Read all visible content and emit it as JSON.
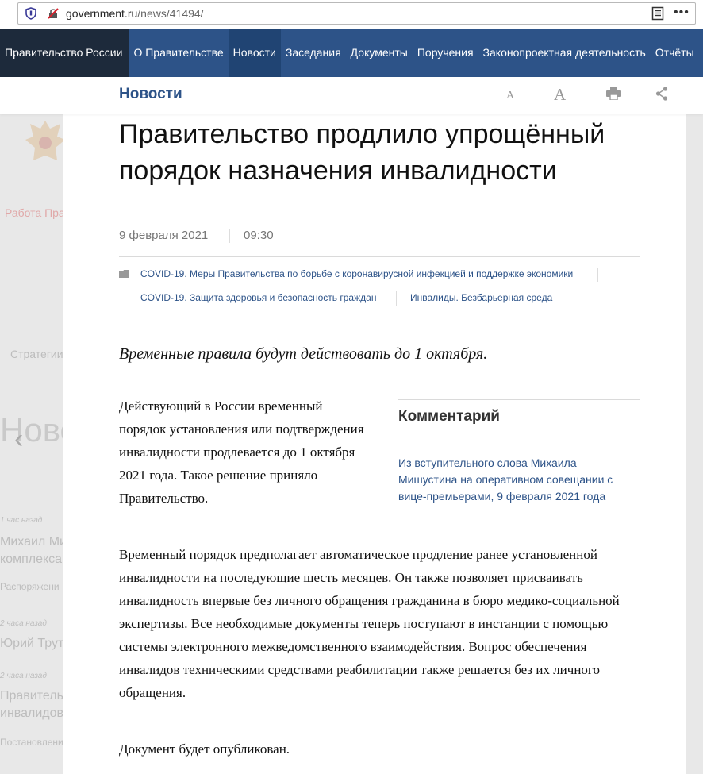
{
  "browser": {
    "url_domain": "government.ru",
    "url_path": "/news/41494/",
    "menu_glyph": "•••"
  },
  "topnav": {
    "brand": "Правительство России",
    "items": [
      "О Правительстве",
      "Новости",
      "Заседания",
      "Документы",
      "Поручения",
      "Законопроектная деятельность",
      "Отчёты"
    ],
    "active_index": 1
  },
  "section": {
    "title": "Новости",
    "font_small_label": "A",
    "font_large_label": "A"
  },
  "background": {
    "work_link": "Работа Пра",
    "strategies": "Стратегии",
    "heading": "Ново",
    "prev_arrow": "‹",
    "items": [
      {
        "time": "1 час назад",
        "title1": "Михаил Ми",
        "title2": "комплекса",
        "sub": "Распоряжени"
      },
      {
        "time": "2 часа назад",
        "title1": "Юрий Труте",
        "title2": "",
        "sub": ""
      },
      {
        "time": "2 часа назад",
        "title1": "Правитель",
        "title2": "инвалидов",
        "sub": "Постановлени"
      }
    ]
  },
  "article": {
    "title": "Правительство продлило упрощённый порядок назначения инвалидности",
    "date": "9 февраля 2021",
    "time": "09:30",
    "tags": [
      "COVID-19. Меры Правительства по борьбе с коронавирусной инфекцией и поддержке экономики",
      "COVID-19. Защита здоровья и безопасность граждан",
      "Инвалиды. Безбарьерная среда"
    ],
    "lead": "Временные правила будут действовать до 1 октября.",
    "paragraph1": "Действующий в России временный порядок установления или подтверждения инвалидности продлевается до 1 октября 2021 года. Такое решение приняло Правительство.",
    "comment": {
      "title": "Комментарий",
      "link": "Из вступительного слова Михаила Мишустина на оперативном совещании с вице-премьерами, 9 февраля 2021 года"
    },
    "paragraph2": "Временный порядок предполагает автоматическое продление ранее установленной инвалидности на последующие шесть месяцев. Он также позволяет присваивать инвалидность впервые без личного обращения гражданина в бюро медико-социальной экспертизы. Все необходимые документы теперь поступают в инстанции с помощью системы электронного межведомственного взаимодействия. Вопрос обеспечения инвалидов техническими средствами реабилитации также решается без их личного обращения.",
    "paragraph3": "Документ будет опубликован."
  },
  "colors": {
    "brand_dark": "#1d2a3b",
    "nav_blue": "#2d5388",
    "nav_active": "#204473",
    "link_blue": "#2d5388"
  }
}
